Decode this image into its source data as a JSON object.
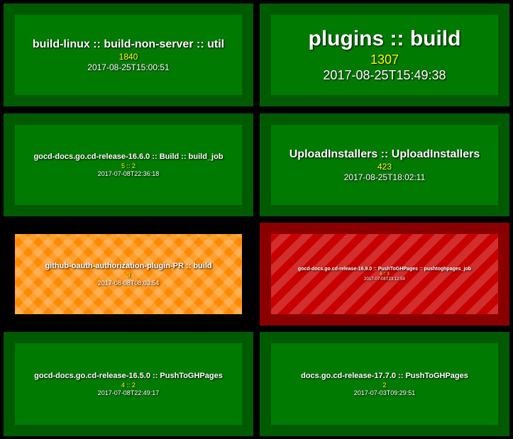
{
  "colors": {
    "passed_outer": "#005a00",
    "passed_inner": "#007a00",
    "building": "#ff8a00",
    "failed_outer": "#8a0000",
    "failed_inner": "#c80000",
    "counter": "#ffff00"
  },
  "tiles": [
    {
      "status": "passed",
      "name": "build-linux :: build-non-server :: util",
      "counter": "1840",
      "time": "2017-08-25T15:00:51"
    },
    {
      "status": "passed",
      "name": "plugins :: build",
      "counter": "1307",
      "time": "2017-08-25T15:49:38"
    },
    {
      "status": "passed",
      "name": "gocd-docs.go.cd-release-16.6.0 :: Build :: build_job",
      "counter": "5 :: 2",
      "time": "2017-07-08T22:36:18"
    },
    {
      "status": "passed",
      "name": "UploadInstallers :: UploadInstallers",
      "counter": "423",
      "time": "2017-08-25T18:02:11"
    },
    {
      "status": "building",
      "name": "github-oauth-authorization-plugin-PR :: build",
      "counter": "3",
      "time": "2017-08-08T08:03:54"
    },
    {
      "status": "failed",
      "name": "gocd-docs.go.cd-release-16.9.0 :: PushToGHPages :: pushtoghpages_job",
      "counter": "6 :: 3",
      "time": "2017-07-08T23:12:59"
    },
    {
      "status": "passed",
      "name": "gocd-docs.go.cd-release-16.5.0 :: PushToGHPages",
      "counter": "4 :: 2",
      "time": "2017-07-08T22:49:17"
    },
    {
      "status": "passed",
      "name": "docs.go.cd-release-17.7.0 :: PushToGHPages",
      "counter": "2",
      "time": "2017-07-03T09:29:51"
    }
  ]
}
